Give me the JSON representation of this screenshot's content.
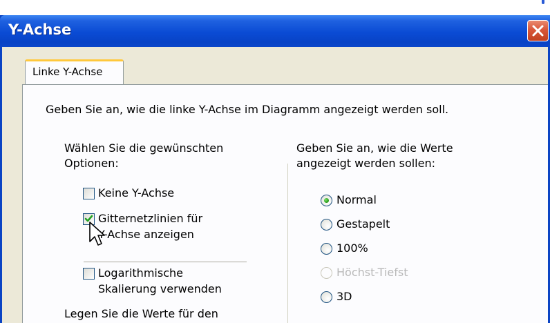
{
  "window": {
    "title": "Y-Achse",
    "close_icon": "close-icon",
    "title_color": "#0a4bd4"
  },
  "tabs": [
    {
      "label": "Linke Y-Achse",
      "selected": true
    }
  ],
  "panel": {
    "description": "Geben Sie an, wie die linke Y-Achse im Diagramm angezeigt werden soll.",
    "left": {
      "heading_line1": "Wählen Sie die gewünschten",
      "heading_line2": "Optionen:",
      "options": [
        {
          "label_line1": "Keine Y-Achse",
          "label_line2": "",
          "checked": false
        },
        {
          "label_line1": "Gitternetzlinien für",
          "label_line2": "Y-Achse anzeigen",
          "checked": true
        },
        {
          "label_line1": "Logarithmische",
          "label_line2": "Skalierung verwenden",
          "checked": false
        }
      ],
      "footer": "Legen Sie die Werte für den"
    },
    "right": {
      "heading_line1": "Geben Sie an, wie die Werte",
      "heading_line2": "angezeigt werden sollen:",
      "radios": [
        {
          "label": "Normal",
          "selected": true,
          "enabled": true
        },
        {
          "label": "Gestapelt",
          "selected": false,
          "enabled": true
        },
        {
          "label": "100%",
          "selected": false,
          "enabled": true
        },
        {
          "label": "Höchst-Tiefst",
          "selected": false,
          "enabled": false
        },
        {
          "label": "3D",
          "selected": false,
          "enabled": true
        }
      ]
    }
  },
  "colors": {
    "titlebar": "#0a4bd4",
    "client": "#ece9d8",
    "tab_highlight": "#ffc83c",
    "check_mark": "#21a121",
    "close_button": "#d9573a"
  }
}
